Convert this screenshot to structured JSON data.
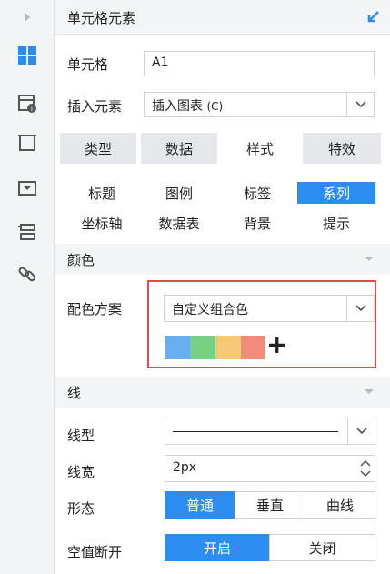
{
  "header": {
    "title": "单元格元素"
  },
  "cell": {
    "label": "单元格",
    "value": "A1"
  },
  "insert": {
    "label": "插入元素",
    "value": "插入图表",
    "shortcut": "(C)"
  },
  "tabs": [
    {
      "label": "类型",
      "active": false
    },
    {
      "label": "数据",
      "active": false
    },
    {
      "label": "样式",
      "active": true
    },
    {
      "label": "特效",
      "active": false
    }
  ],
  "subtabs": [
    {
      "label": "标题",
      "active": false
    },
    {
      "label": "图例",
      "active": false
    },
    {
      "label": "标签",
      "active": false
    },
    {
      "label": "系列",
      "active": true
    },
    {
      "label": "坐标轴",
      "active": false
    },
    {
      "label": "数据表",
      "active": false
    },
    {
      "label": "背景",
      "active": false
    },
    {
      "label": "提示",
      "active": false
    }
  ],
  "color_section": {
    "title": "颜色",
    "scheme_label": "配色方案",
    "scheme_value": "自定义组合色",
    "swatches": [
      "#6aaef2",
      "#78d183",
      "#f5c873",
      "#f48b7b"
    ],
    "add_symbol": "+"
  },
  "line_section": {
    "title": "线",
    "type_label": "线型",
    "width_label": "线宽",
    "width_value": "2px",
    "shape_label": "形态",
    "shape_options": [
      {
        "label": "普通",
        "active": true
      },
      {
        "label": "垂直",
        "active": false
      },
      {
        "label": "曲线",
        "active": false
      }
    ],
    "null_label": "空值断开",
    "null_options": [
      {
        "label": "开启",
        "active": true
      },
      {
        "label": "关闭",
        "active": false
      }
    ]
  },
  "colors": {
    "accent": "#2d8cf0",
    "highlight": "#e24a4a",
    "sidebar_icon": "#2d8cf0"
  },
  "sidebar_icons": [
    "expand-arrow-icon",
    "cell-element-icon",
    "cell-attribute-icon",
    "widget-icon",
    "dropdown-widget-icon",
    "layout-icon",
    "link-icon"
  ]
}
